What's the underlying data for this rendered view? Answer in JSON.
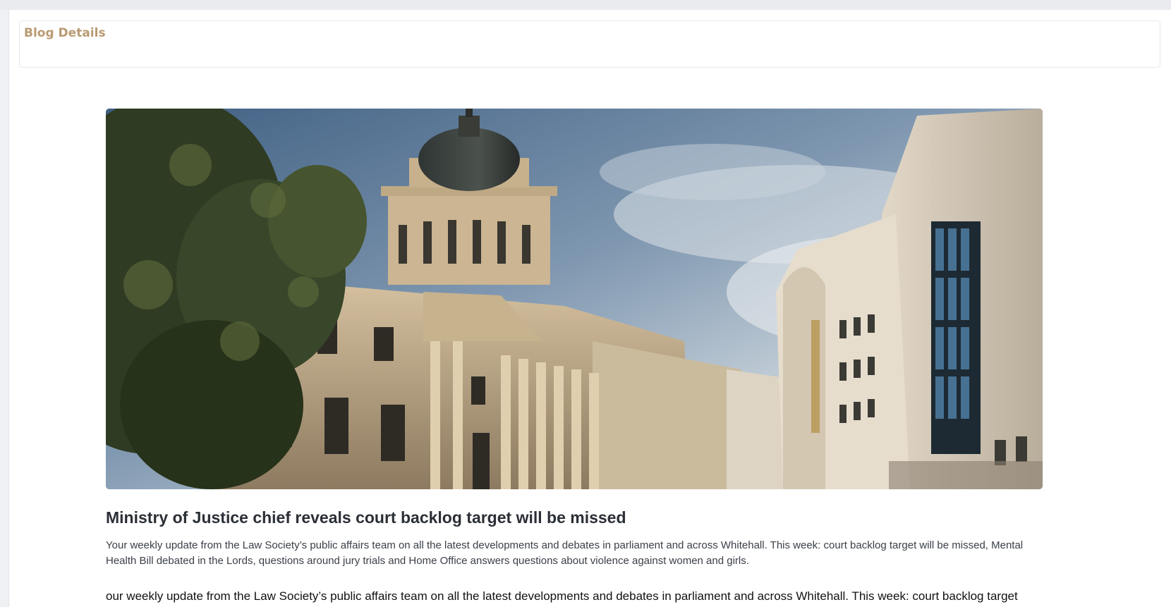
{
  "header": {
    "title": "Blog Details"
  },
  "article": {
    "image_subject": "courthouse-building-photo",
    "title": "Ministry of Justice chief reveals court backlog target will be missed",
    "summary": "Your weekly update from the Law Society’s public affairs team on all the latest developments and debates in parliament and across Whitehall. This week: court backlog target will be missed, Mental Health Bill debated in the Lords, questions around jury trials and Home Office answers questions about violence against women and girls.",
    "body_first_line": "our weekly update from the Law Society’s public affairs team on all the latest developments and debates in parliament and across Whitehall. This week: court backlog target"
  },
  "colors": {
    "accent": "#b99a72",
    "title_text": "#2b2f36",
    "body_text": "#3b4048",
    "page_bg": "#eef0f3",
    "panel_bg": "#ffffff"
  }
}
